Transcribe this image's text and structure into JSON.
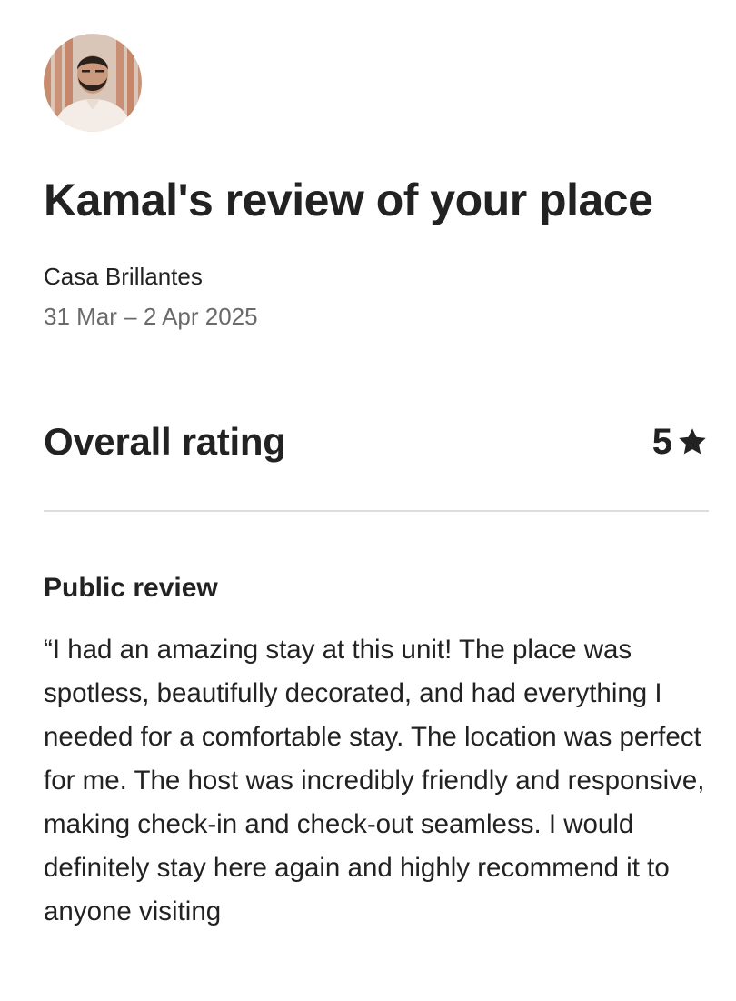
{
  "header": {
    "avatar_icon": "guest-avatar-photo",
    "title": "Kamal's review of your place"
  },
  "listing": {
    "name": "Casa Brillantes",
    "dates": "31 Mar – 2 Apr 2025"
  },
  "rating": {
    "label": "Overall rating",
    "value": "5",
    "icon": "star-icon"
  },
  "review": {
    "label": "Public review",
    "text": "“I had an amazing stay at this unit! The place was spotless, beautifully decorated, and had everything I needed for a comfortable stay. The location was perfect for me. The host was incredibly friendly and responsive, making check-in and check-out seamless. I would definitely stay here again and highly recommend it to anyone visiting"
  },
  "colors": {
    "text_primary": "#222222",
    "text_secondary": "#6a6a6a",
    "divider": "#dddddd"
  }
}
